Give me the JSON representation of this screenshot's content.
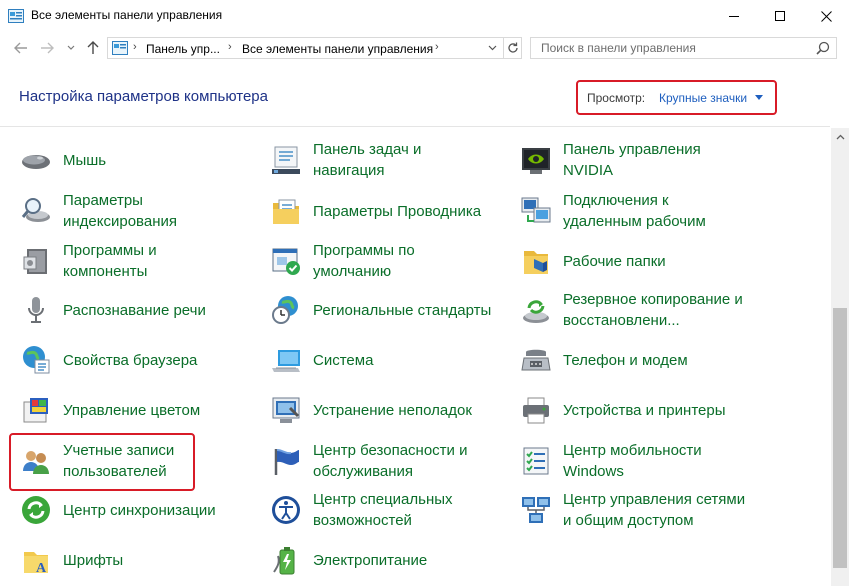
{
  "window": {
    "title": "Все элементы панели управления"
  },
  "address": {
    "crumbs": [
      "Панель упр...",
      "Все элементы панели управления"
    ]
  },
  "search": {
    "placeholder": "Поиск в панели управления"
  },
  "header": {
    "title": "Настройка параметров компьютера",
    "view_label": "Просмотр:",
    "view_value": "Крупные значки"
  },
  "colors": {
    "link_green": "#0a6e29",
    "title_blue": "#1e3287",
    "highlight_red": "#d81b27",
    "view_blue": "#1f5fbf"
  },
  "items": [
    {
      "label": "Мышь",
      "icon": "mouse-icon"
    },
    {
      "label": "Панель задач и\nнавигация",
      "icon": "taskbar-icon"
    },
    {
      "label": "Панель управления\nNVIDIA",
      "icon": "nvidia-icon"
    },
    {
      "label": "Параметры\nиндексирования",
      "icon": "indexing-icon"
    },
    {
      "label": "Параметры Проводника",
      "icon": "folder-options-icon"
    },
    {
      "label": "Подключения к\nудаленным рабочим",
      "icon": "remote-desktop-icon"
    },
    {
      "label": "Программы и\nкомпоненты",
      "icon": "programs-icon"
    },
    {
      "label": "Программы по\nумолчанию",
      "icon": "default-programs-icon"
    },
    {
      "label": "Рабочие папки",
      "icon": "work-folders-icon"
    },
    {
      "label": "Распознавание речи",
      "icon": "microphone-icon"
    },
    {
      "label": "Региональные стандарты",
      "icon": "region-icon"
    },
    {
      "label": "Резервное копирование и\nвосстановлени...",
      "icon": "backup-icon"
    },
    {
      "label": "Свойства браузера",
      "icon": "internet-options-icon"
    },
    {
      "label": "Система",
      "icon": "system-icon"
    },
    {
      "label": "Телефон и модем",
      "icon": "phone-modem-icon"
    },
    {
      "label": "Управление цветом",
      "icon": "color-management-icon"
    },
    {
      "label": "Устранение неполадок",
      "icon": "troubleshooting-icon"
    },
    {
      "label": "Устройства и принтеры",
      "icon": "devices-printers-icon"
    },
    {
      "label": "Учетные записи\nпользователей",
      "icon": "user-accounts-icon"
    },
    {
      "label": "Центр безопасности и\nобслуживания",
      "icon": "security-flag-icon"
    },
    {
      "label": "Центр мобильности\nWindows",
      "icon": "mobility-center-icon"
    },
    {
      "label": "Центр синхронизации",
      "icon": "sync-center-icon"
    },
    {
      "label": "Центр специальных\nвозможностей",
      "icon": "ease-of-access-icon"
    },
    {
      "label": "Центр управления сетями\nи общим доступом",
      "icon": "network-center-icon"
    },
    {
      "label": "Шрифты",
      "icon": "fonts-icon"
    },
    {
      "label": "Электропитание",
      "icon": "power-options-icon"
    }
  ]
}
